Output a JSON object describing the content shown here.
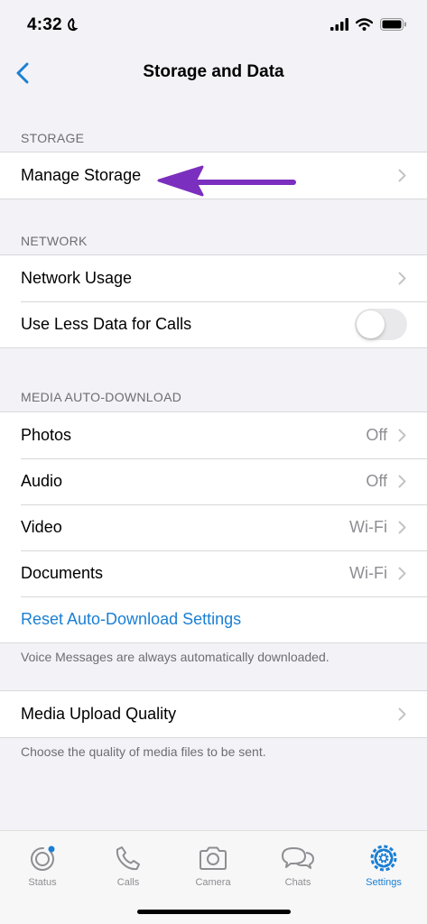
{
  "status_bar": {
    "time": "4:32"
  },
  "nav": {
    "title": "Storage and Data"
  },
  "storage": {
    "header": "STORAGE",
    "manage_storage": "Manage Storage"
  },
  "network": {
    "header": "NETWORK",
    "network_usage": "Network Usage",
    "use_less_data": "Use Less Data for Calls",
    "use_less_data_enabled": false
  },
  "media_auto_download": {
    "header": "MEDIA AUTO-DOWNLOAD",
    "items": [
      {
        "label": "Photos",
        "value": "Off"
      },
      {
        "label": "Audio",
        "value": "Off"
      },
      {
        "label": "Video",
        "value": "Wi-Fi"
      },
      {
        "label": "Documents",
        "value": "Wi-Fi"
      }
    ],
    "reset": "Reset Auto-Download Settings",
    "footnote": "Voice Messages are always automatically downloaded."
  },
  "upload": {
    "media_upload_quality": "Media Upload Quality",
    "footnote": "Choose the quality of media files to be sent."
  },
  "tabs": [
    {
      "label": "Status",
      "icon": "status-icon"
    },
    {
      "label": "Calls",
      "icon": "phone-icon"
    },
    {
      "label": "Camera",
      "icon": "camera-icon"
    },
    {
      "label": "Chats",
      "icon": "chats-icon"
    },
    {
      "label": "Settings",
      "icon": "gear-icon",
      "active": true
    }
  ],
  "colors": {
    "accent": "#1a7fd4",
    "annotation_arrow": "#7b2fbe",
    "background": "#f2f2f7"
  }
}
